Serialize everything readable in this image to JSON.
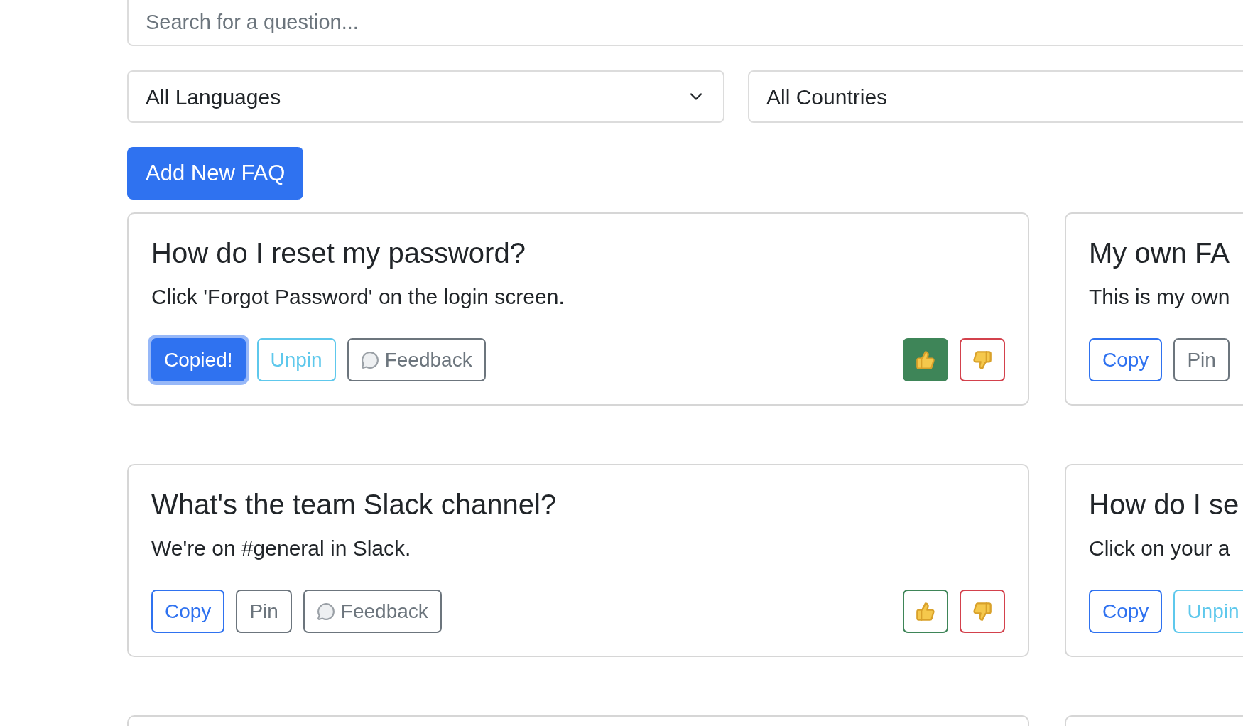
{
  "search": {
    "placeholder": "Search for a question..."
  },
  "filters": [
    {
      "value": "All Languages",
      "caret": true
    },
    {
      "value": "All Countries"
    }
  ],
  "add_button": "Add New FAQ",
  "rows": [
    {
      "cards": [
        {
          "title": "How do I reset my password?",
          "answer": "Click 'Forgot Password' on the login screen.",
          "actions": [
            {
              "kind": "copy",
              "label": "Copied!",
              "active": true
            },
            {
              "kind": "pin",
              "label": "Unpin",
              "pinned": true
            },
            {
              "kind": "feedback",
              "label": "Feedback"
            }
          ],
          "votes": {
            "up_selected": true,
            "down_selected": false
          }
        },
        {
          "title": "My own FA",
          "answer": "This is my own",
          "actions": [
            {
              "kind": "copy",
              "label": "Copy",
              "active": false
            },
            {
              "kind": "pin",
              "label": "Pin",
              "pinned": false
            }
          ]
        }
      ]
    },
    {
      "cards": [
        {
          "title": "What's the team Slack channel?",
          "answer": "We're on #general in Slack.",
          "actions": [
            {
              "kind": "copy",
              "label": "Copy",
              "active": false
            },
            {
              "kind": "pin",
              "label": "Pin",
              "pinned": false
            },
            {
              "kind": "feedback",
              "label": "Feedback"
            }
          ],
          "votes": {
            "up_selected": false,
            "down_selected": false
          }
        },
        {
          "title": "How do I se",
          "answer": "Click on your a",
          "actions": [
            {
              "kind": "copy",
              "label": "Copy",
              "active": false
            },
            {
              "kind": "pin",
              "label": "Unpin",
              "pinned": true
            }
          ]
        }
      ]
    }
  ]
}
